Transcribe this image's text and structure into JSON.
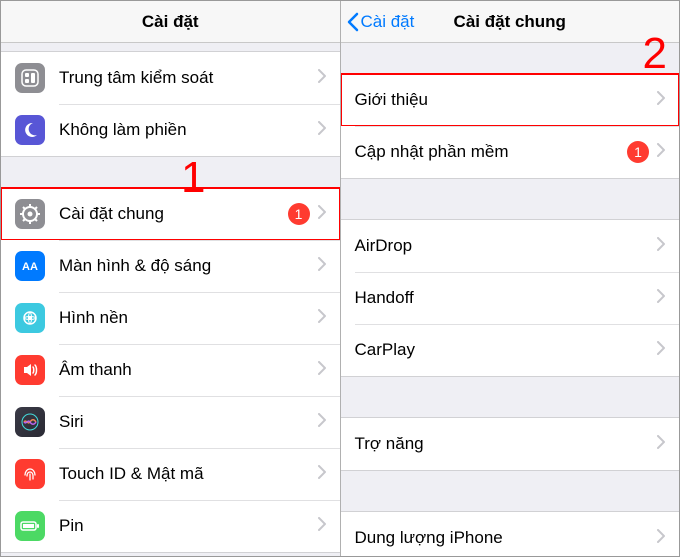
{
  "annotations": {
    "one": "1",
    "two": "2"
  },
  "left": {
    "title": "Cài đặt",
    "rows": {
      "control_center": "Trung tâm kiểm soát",
      "dnd": "Không làm phiền",
      "general": "Cài đặt chung",
      "general_badge": "1",
      "display": "Màn hình & độ sáng",
      "wallpaper": "Hình nền",
      "sound": "Âm thanh",
      "siri": "Siri",
      "touchid": "Touch ID & Mật mã",
      "battery": "Pin"
    }
  },
  "right": {
    "back": "Cài đặt",
    "title": "Cài đặt chung",
    "rows": {
      "about": "Giới thiệu",
      "software_update": "Cập nhật phần mềm",
      "software_update_badge": "1",
      "airdrop": "AirDrop",
      "handoff": "Handoff",
      "carplay": "CarPlay",
      "accessibility": "Trợ năng",
      "storage": "Dung lượng iPhone"
    }
  }
}
